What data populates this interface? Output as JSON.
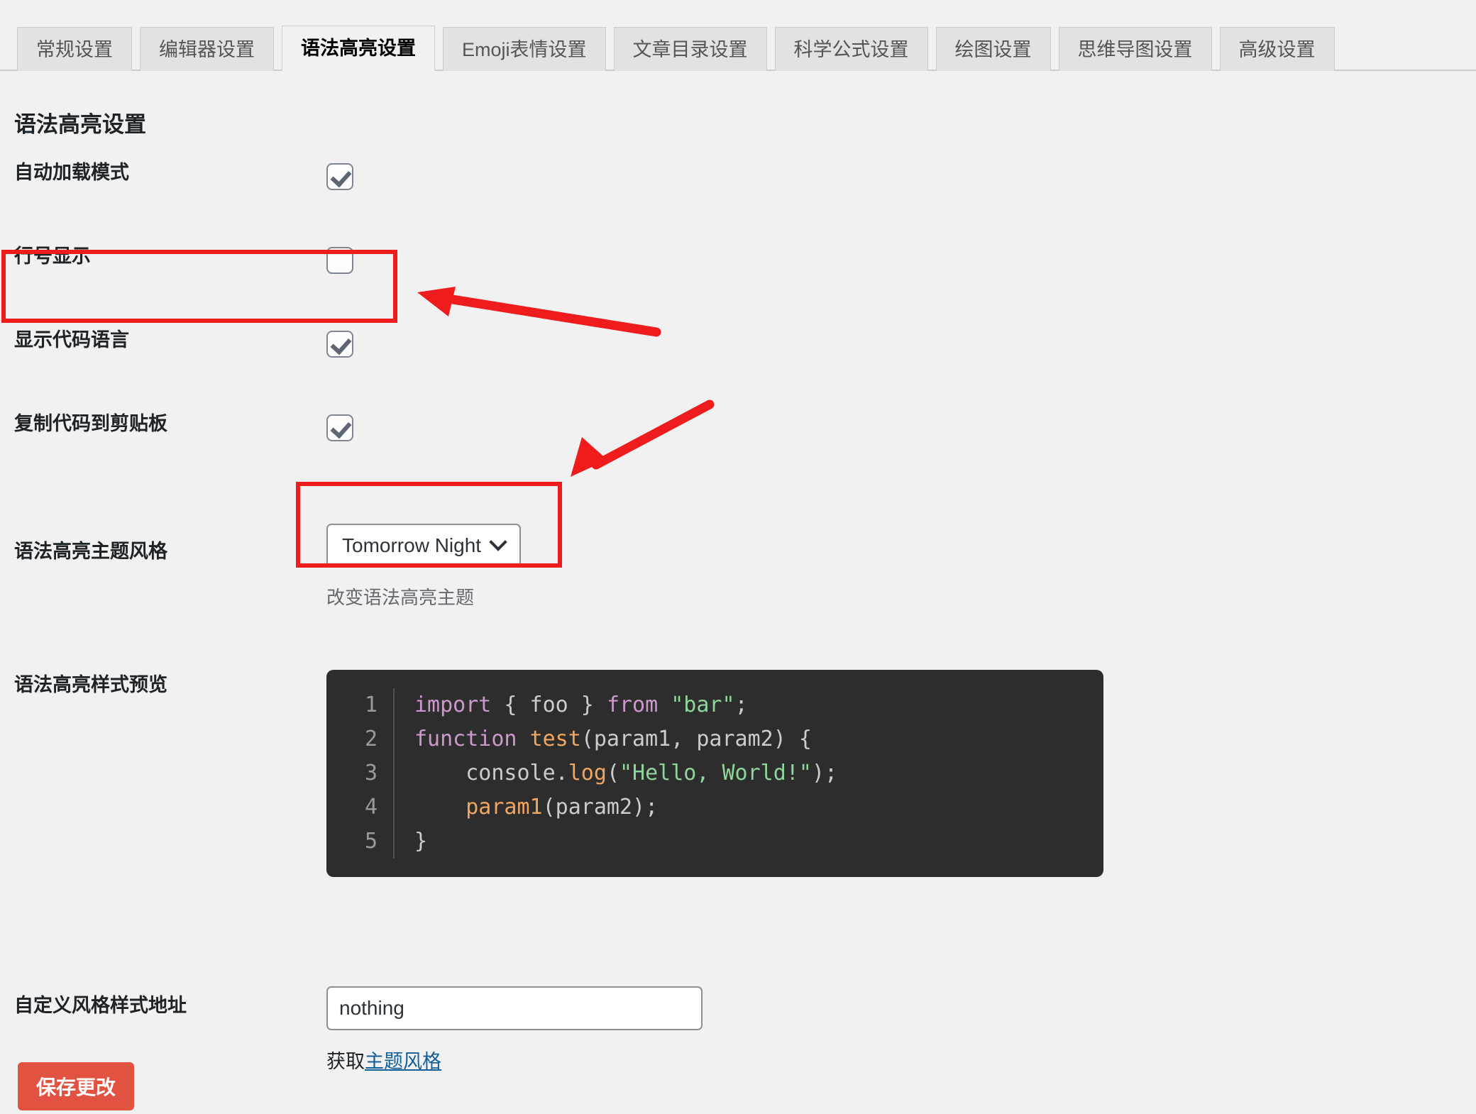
{
  "tabs": [
    {
      "label": "常规设置",
      "active": false
    },
    {
      "label": "编辑器设置",
      "active": false
    },
    {
      "label": "语法高亮设置",
      "active": true
    },
    {
      "label": "Emoji表情设置",
      "active": false
    },
    {
      "label": "文章目录设置",
      "active": false
    },
    {
      "label": "科学公式设置",
      "active": false
    },
    {
      "label": "绘图设置",
      "active": false
    },
    {
      "label": "思维导图设置",
      "active": false
    },
    {
      "label": "高级设置",
      "active": false
    }
  ],
  "page": {
    "title": "语法高亮设置"
  },
  "rows": {
    "autoload": {
      "label": "自动加载模式",
      "checked": true
    },
    "linenumber": {
      "label": "行号显示",
      "checked": false
    },
    "showlang": {
      "label": "显示代码语言",
      "checked": true
    },
    "copyclip": {
      "label": "复制代码到剪贴板",
      "checked": true
    },
    "theme": {
      "label": "语法高亮主题风格",
      "value": "Tomorrow Night",
      "hint": "改变语法高亮主题"
    },
    "preview": {
      "label": "语法高亮样式预览"
    },
    "customcss": {
      "label": "自定义风格样式地址",
      "value": "nothing",
      "placeholder": "",
      "link_prefix": "获取",
      "link_text": "主题风格"
    }
  },
  "code_preview": {
    "lines": [
      {
        "number": "1",
        "tokens": [
          {
            "t": "import",
            "c": "k"
          },
          {
            "t": " { foo } ",
            "c": "p"
          },
          {
            "t": "from",
            "c": "k"
          },
          {
            "t": " ",
            "c": "p"
          },
          {
            "t": "\"bar\"",
            "c": "s"
          },
          {
            "t": ";",
            "c": "p"
          }
        ]
      },
      {
        "number": "2",
        "tokens": [
          {
            "t": "function",
            "c": "k"
          },
          {
            "t": " ",
            "c": "p"
          },
          {
            "t": "test",
            "c": "fn"
          },
          {
            "t": "(param1, param2) {",
            "c": "p"
          }
        ]
      },
      {
        "number": "3",
        "tokens": [
          {
            "t": "    console.",
            "c": "p"
          },
          {
            "t": "log",
            "c": "fn"
          },
          {
            "t": "(",
            "c": "p"
          },
          {
            "t": "\"Hello, World!\"",
            "c": "s"
          },
          {
            "t": ");",
            "c": "p"
          }
        ]
      },
      {
        "number": "4",
        "tokens": [
          {
            "t": "    ",
            "c": "p"
          },
          {
            "t": "param1",
            "c": "fn"
          },
          {
            "t": "(param2);",
            "c": "p"
          }
        ]
      },
      {
        "number": "5",
        "tokens": [
          {
            "t": "}",
            "c": "p"
          }
        ]
      }
    ]
  },
  "footer": {
    "save_label": "保存更改"
  },
  "colors": {
    "annotation_red": "#ee1c1c",
    "save_button": "#e15241",
    "link": "#135e96",
    "code_bg": "#2d2d2d",
    "keyword": "#cc99cc",
    "function": "#f2a560",
    "string": "#8fd49b",
    "plain": "#cccccc"
  }
}
